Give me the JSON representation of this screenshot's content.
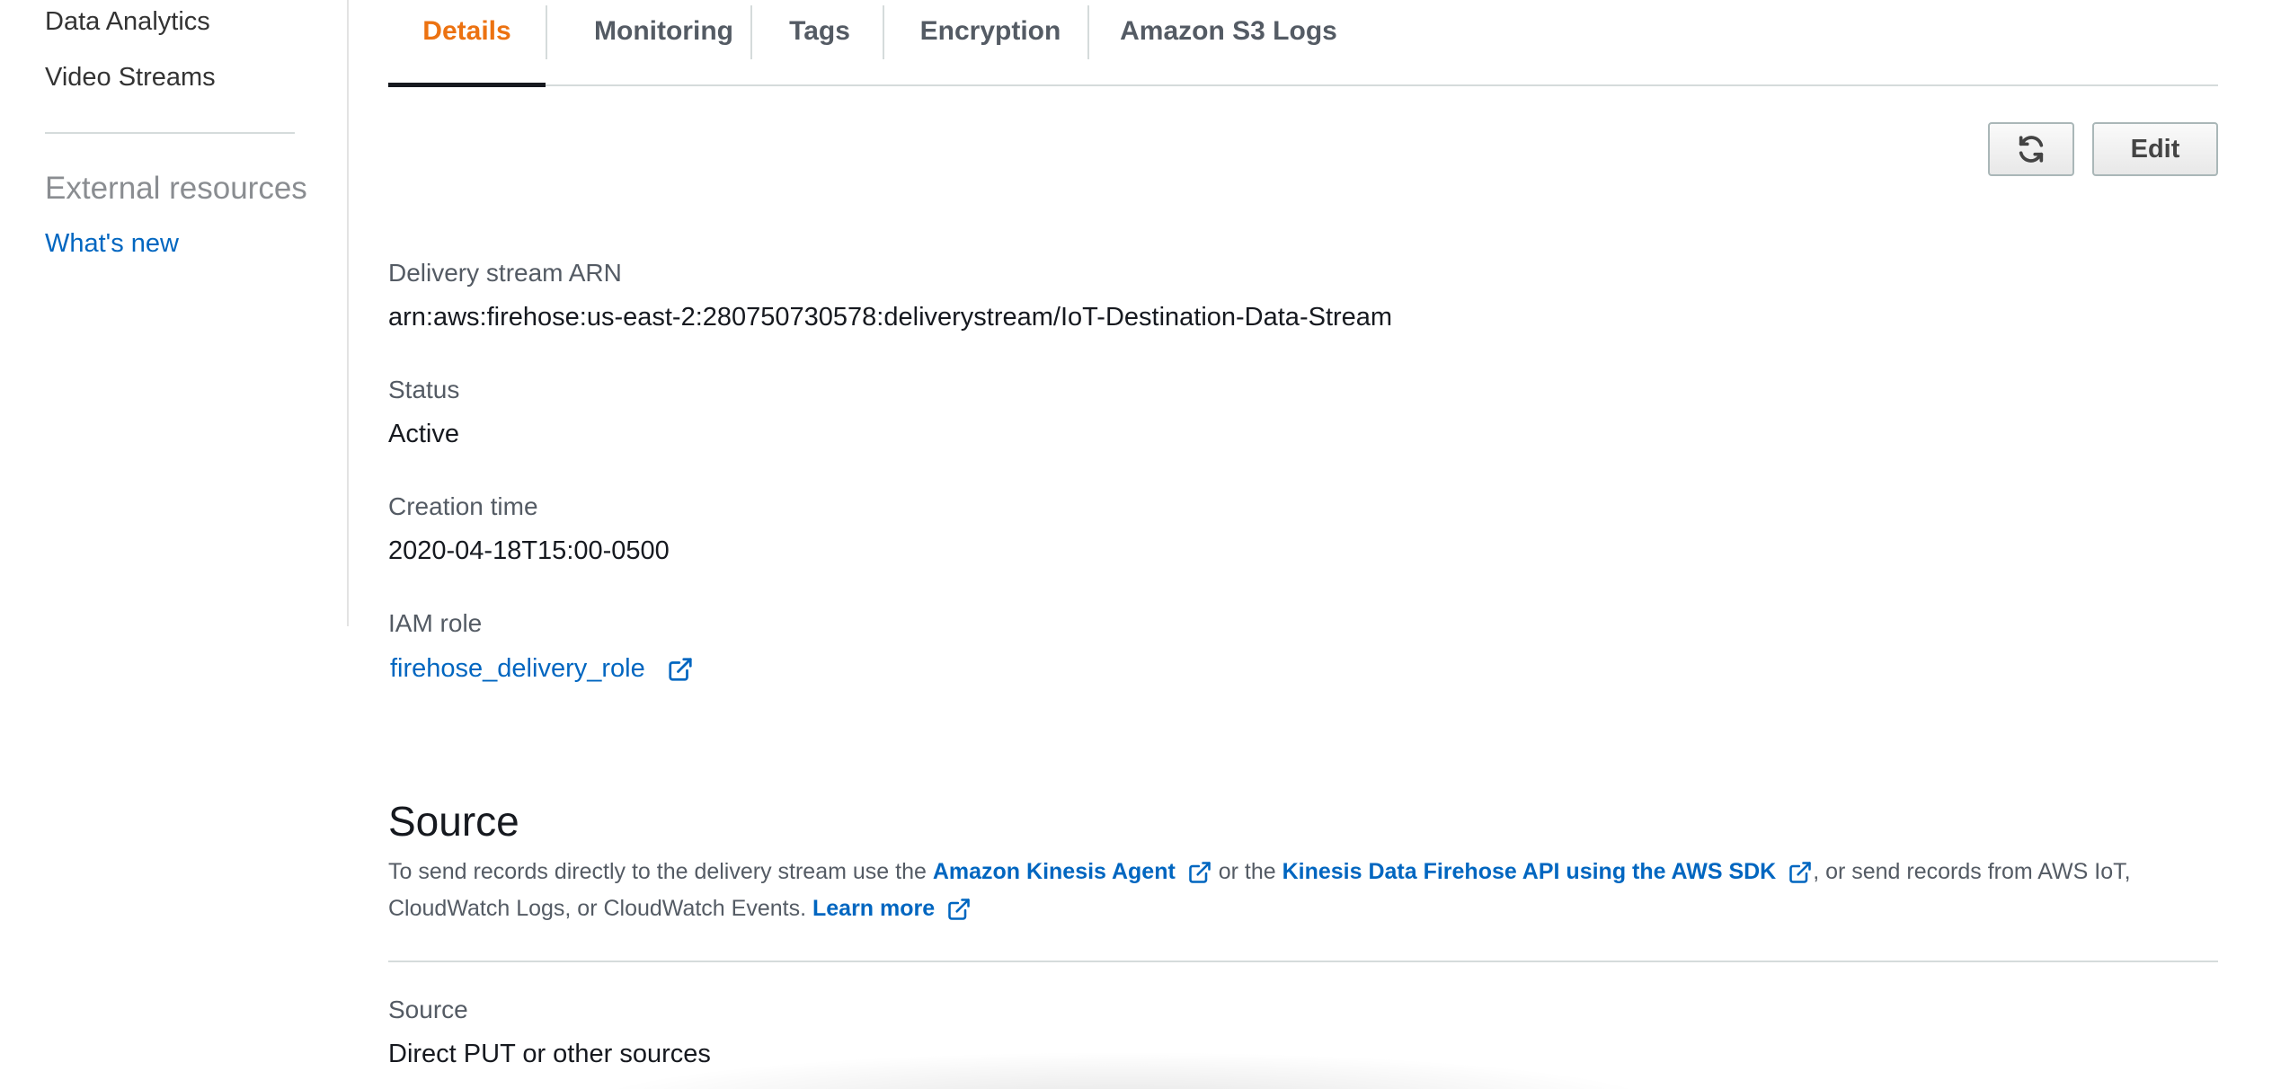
{
  "sidebar": {
    "items": [
      {
        "label": "Data Analytics"
      },
      {
        "label": "Video Streams"
      }
    ],
    "external_heading": "External resources",
    "whats_new": "What's new"
  },
  "tabs": [
    {
      "label": "Details",
      "active": true
    },
    {
      "label": "Monitoring",
      "active": false
    },
    {
      "label": "Tags",
      "active": false
    },
    {
      "label": "Encryption",
      "active": false
    },
    {
      "label": "Amazon S3 Logs",
      "active": false
    }
  ],
  "toolbar": {
    "refresh_icon": "refresh-icon",
    "edit_label": "Edit"
  },
  "details": {
    "arn_label": "Delivery stream ARN",
    "arn_value": "arn:aws:firehose:us-east-2:280750730578:deliverystream/IoT-Destination-Data-Stream",
    "status_label": "Status",
    "status_value": "Active",
    "creation_label": "Creation time",
    "creation_value": "2020-04-18T15:00-0500",
    "iam_label": "IAM role",
    "iam_value": "firehose_delivery_role"
  },
  "source": {
    "title": "Source",
    "desc_1": "To send records directly to the delivery stream use the ",
    "link_agent": "Amazon Kinesis Agent",
    "desc_2": " or the ",
    "link_api": "Kinesis Data Firehose API using the AWS SDK",
    "desc_3": ", or send records from AWS IoT, CloudWatch Logs, or CloudWatch Events. ",
    "link_learn": "Learn more",
    "source_label": "Source",
    "source_value": "Direct PUT or other sources"
  },
  "colors": {
    "accent": "#ec7211",
    "link": "#0066c0"
  }
}
